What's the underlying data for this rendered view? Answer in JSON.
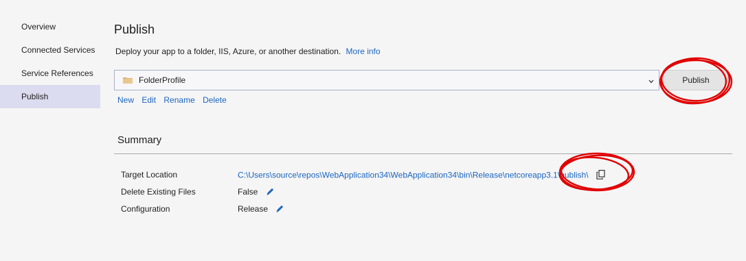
{
  "sidebar": {
    "items": [
      {
        "label": "Overview"
      },
      {
        "label": "Connected Services"
      },
      {
        "label": "Service References"
      },
      {
        "label": "Publish"
      }
    ]
  },
  "main": {
    "title": "Publish",
    "subtitle": "Deploy your app to a folder, IIS, Azure, or another destination.",
    "more_info": "More info",
    "profile": "FolderProfile",
    "publish_button": "Publish",
    "actions": {
      "new": "New",
      "edit": "Edit",
      "rename": "Rename",
      "delete": "Delete"
    }
  },
  "summary": {
    "title": "Summary",
    "rows": [
      {
        "label": "Target Location",
        "value": "C:\\Users\\source\\repos\\WebApplication34\\WebApplication34\\bin\\Release\\netcoreapp3.1\\publish\\"
      },
      {
        "label": "Delete Existing Files",
        "value": "False"
      },
      {
        "label": "Configuration",
        "value": "Release"
      }
    ]
  },
  "colors": {
    "link": "#1a65c0",
    "active_nav": "#dcdcf0",
    "annotation": "#e00000"
  },
  "icons": [
    "folder-icon",
    "chevron-down-icon",
    "copy-icon",
    "pencil-icon"
  ]
}
